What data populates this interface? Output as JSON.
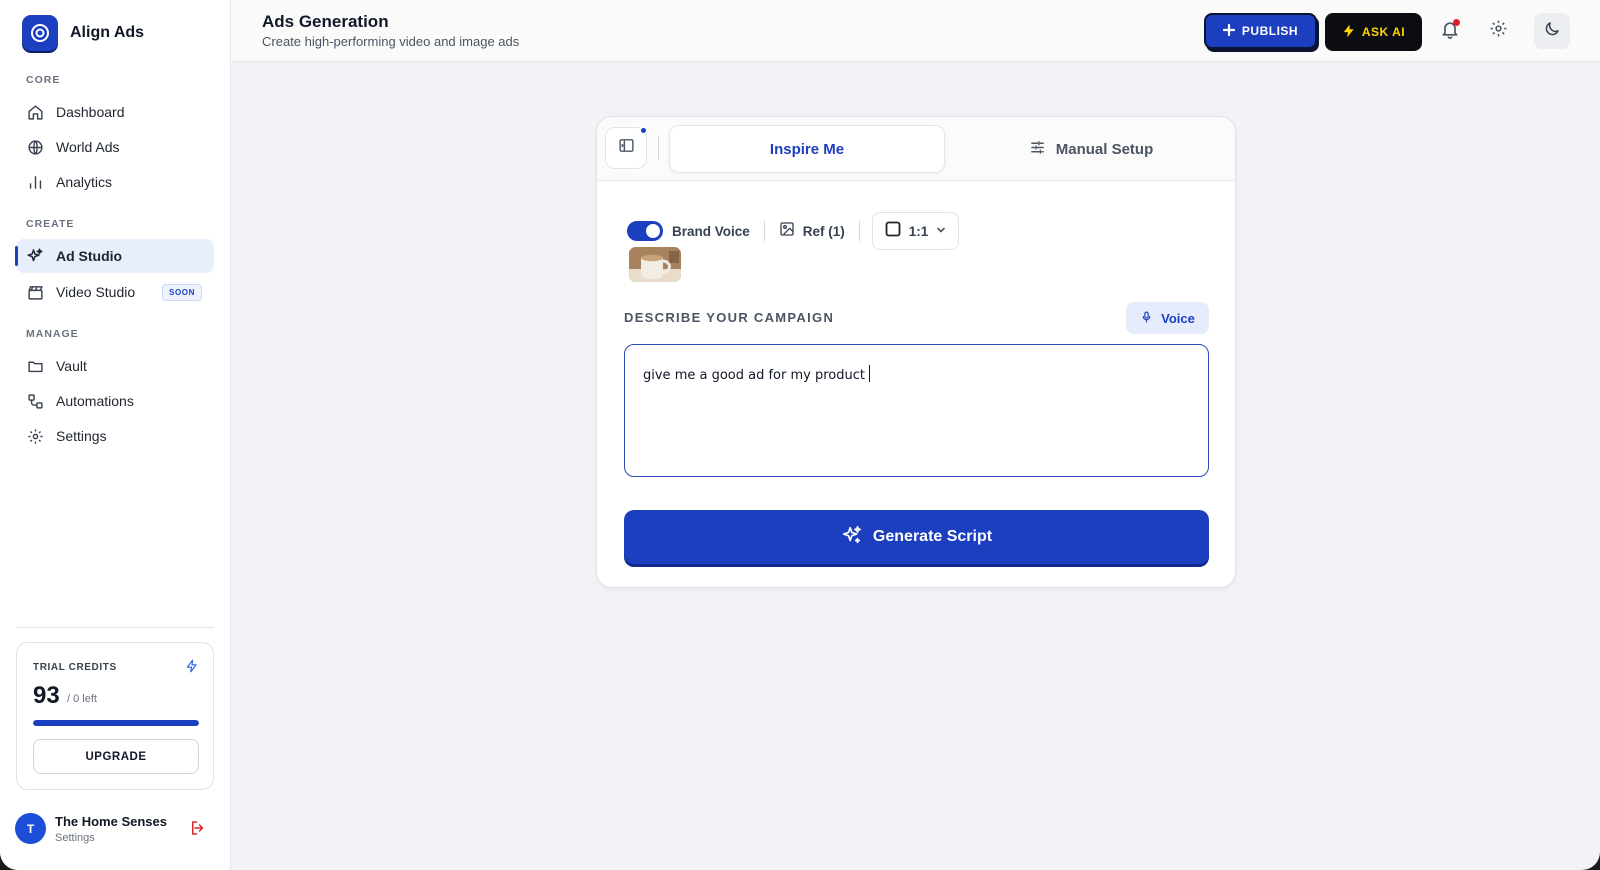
{
  "brand": {
    "name": "Align Ads"
  },
  "sidebar": {
    "sections": {
      "core": "CORE",
      "create": "CREATE",
      "manage": "MANAGE"
    },
    "items": [
      {
        "label": "Dashboard",
        "icon": "home-icon"
      },
      {
        "label": "World Ads",
        "icon": "globe-icon"
      },
      {
        "label": "Analytics",
        "icon": "bar-chart-icon"
      },
      {
        "label": "Ad Studio",
        "icon": "sparkles-icon",
        "active": true
      },
      {
        "label": "Video Studio",
        "icon": "clapperboard-icon",
        "badge": "SOON"
      },
      {
        "label": "Vault",
        "icon": "folder-icon"
      },
      {
        "label": "Automations",
        "icon": "workflow-icon"
      },
      {
        "label": "Settings",
        "icon": "gear-icon"
      }
    ]
  },
  "credits": {
    "title": "TRIAL CREDITS",
    "count": "93",
    "left_text": "/ 0 left",
    "fill_fraction": 1.0,
    "upgrade_label": "UPGRADE"
  },
  "user": {
    "initial": "T",
    "name": "The Home Senses",
    "sub": "Settings"
  },
  "header": {
    "title": "Ads Generation",
    "subtitle": "Create high-performing video and image ads",
    "publish_label": "PUBLISH",
    "ask_ai_label": "ASK AI"
  },
  "studio": {
    "tabs": {
      "inspire": "Inspire Me",
      "manual": "Manual Setup"
    },
    "brand_voice_label": "Brand Voice",
    "brand_voice_on": true,
    "ref_label": "Ref (1)",
    "ratio_value": "1:1",
    "describe_label": "DESCRIBE YOUR CAMPAIGN",
    "voice_label": "Voice",
    "prompt_value": "give me a good ad for my product",
    "generate_label": "Generate Script"
  },
  "colors": {
    "accent": "#1c3fbf",
    "ask_ai_bg": "#0b0d12",
    "ask_ai_text": "#ffd400",
    "notification": "#e11d2a"
  }
}
